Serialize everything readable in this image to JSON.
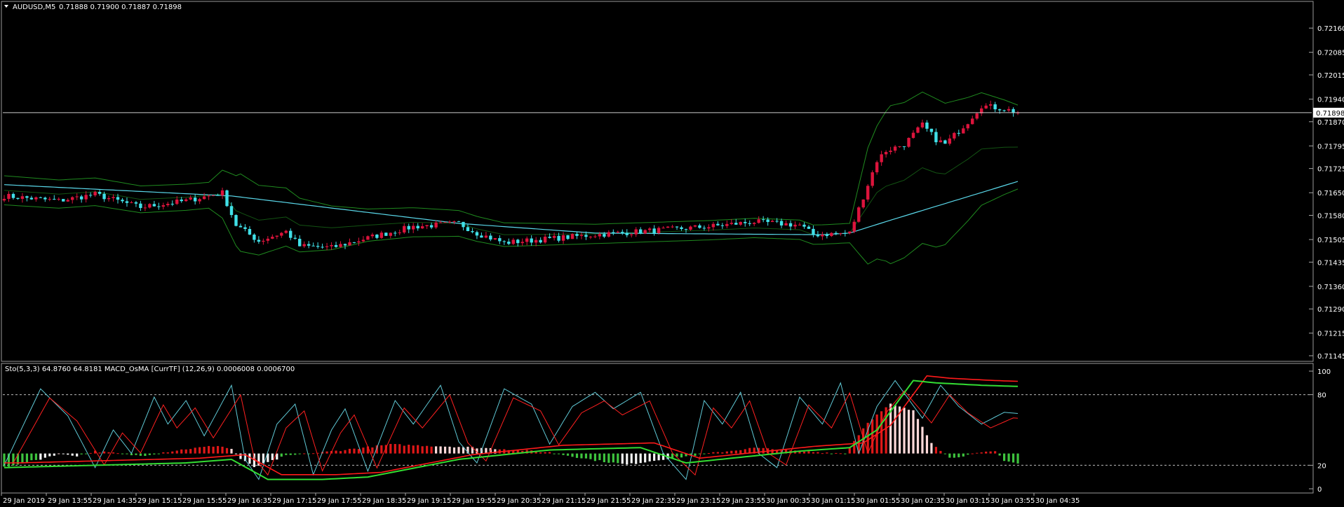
{
  "header": {
    "symbol": "AUDUSD,M5",
    "ohlc": "0.71888 0.71900 0.71887 0.71898"
  },
  "subheader": {
    "indicators": "Sto(5,3,3) 64.8760 64.8181  MACD_OsMA [CurrTF] (12,26,9) 0.0006008 0.0006700"
  },
  "colors": {
    "background": "#000000",
    "bull_candle": "#dc143c",
    "bear_candle": "#40e0e8",
    "bollinger": "#1f8a1f",
    "moving_average": "#5ad8ea",
    "stoch_main": "#5fc9d6",
    "stoch_signal": "#ff2020",
    "osma_signal": "#33dd33",
    "price_line": "#cccccc"
  },
  "chart_data": [
    {
      "type": "candlestick",
      "title": "AUDUSD,M5",
      "current_price": "0.71898",
      "ylim": [
        0.71145,
        0.72195
      ],
      "y_ticks": [
        "0.72160",
        "0.72085",
        "0.72015",
        "0.71940",
        "0.71870",
        "0.71795",
        "0.71725",
        "0.71650",
        "0.71580",
        "0.71505",
        "0.71435",
        "0.71360",
        "0.71290",
        "0.71215",
        "0.71145"
      ],
      "x_ticks": [
        "29 Jan 2019",
        "29 Jan 13:55",
        "29 Jan 14:35",
        "29 Jan 15:15",
        "29 Jan 15:55",
        "29 Jan 16:35",
        "29 Jan 17:15",
        "29 Jan 17:55",
        "29 Jan 18:35",
        "29 Jan 19:15",
        "29 Jan 19:55",
        "29 Jan 20:35",
        "29 Jan 21:15",
        "29 Jan 21:55",
        "29 Jan 22:35",
        "29 Jan 23:15",
        "29 Jan 23:55",
        "30 Jan 00:35",
        "30 Jan 01:15",
        "30 Jan 01:55",
        "30 Jan 02:35",
        "30 Jan 03:15",
        "30 Jan 03:55",
        "30 Jan 04:35"
      ],
      "close_anchors": [
        [
          0,
          0.7164
        ],
        [
          12,
          0.71625
        ],
        [
          20,
          0.71645
        ],
        [
          30,
          0.71605
        ],
        [
          40,
          0.71625
        ],
        [
          48,
          0.7165
        ],
        [
          51,
          0.7155
        ],
        [
          56,
          0.715
        ],
        [
          62,
          0.7153
        ],
        [
          65,
          0.71485
        ],
        [
          72,
          0.7148
        ],
        [
          80,
          0.7151
        ],
        [
          90,
          0.71545
        ],
        [
          100,
          0.71555
        ],
        [
          104,
          0.71525
        ],
        [
          110,
          0.71495
        ],
        [
          118,
          0.71505
        ],
        [
          130,
          0.7152
        ],
        [
          145,
          0.71535
        ],
        [
          155,
          0.71545
        ],
        [
          165,
          0.7156
        ],
        [
          175,
          0.7155
        ],
        [
          178,
          0.7152
        ],
        [
          186,
          0.71525
        ],
        [
          192,
          0.7175
        ],
        [
          194,
          0.7178
        ],
        [
          198,
          0.718
        ],
        [
          202,
          0.7186
        ],
        [
          205,
          0.71815
        ],
        [
          207,
          0.718
        ],
        [
          212,
          0.7187
        ],
        [
          215,
          0.7192
        ],
        [
          220,
          0.7191
        ],
        [
          223,
          0.71898
        ]
      ],
      "ma_anchors": [
        [
          0,
          0.71675
        ],
        [
          50,
          0.7164
        ],
        [
          100,
          0.71555
        ],
        [
          130,
          0.71525
        ],
        [
          180,
          0.7152
        ],
        [
          186,
          0.71525
        ],
        [
          195,
          0.71565
        ],
        [
          223,
          0.71685
        ]
      ],
      "bb_width_anchors": [
        [
          0,
          0.00045
        ],
        [
          45,
          0.0004
        ],
        [
          52,
          0.0012
        ],
        [
          62,
          0.0009
        ],
        [
          80,
          0.0005
        ],
        [
          100,
          0.0004
        ],
        [
          130,
          0.0003
        ],
        [
          186,
          0.0003
        ],
        [
          190,
          0.0018
        ],
        [
          195,
          0.00245
        ],
        [
          205,
          0.0023
        ],
        [
          223,
          0.0013
        ]
      ]
    },
    {
      "type": "oscillator",
      "title": "Sto(5,3,3) / MACD_OsMA",
      "ylim": [
        0,
        100
      ],
      "y_ticks": [
        "100",
        "80",
        "20",
        "0"
      ],
      "levels": [
        80,
        20
      ],
      "stoch_main": 64.876,
      "stoch_signal": 64.8181,
      "osma_value": 0.0006008,
      "signal_value": 0.00067,
      "stoch_anchors": [
        [
          0,
          20
        ],
        [
          8,
          85
        ],
        [
          14,
          62
        ],
        [
          20,
          18
        ],
        [
          24,
          50
        ],
        [
          28,
          30
        ],
        [
          33,
          78
        ],
        [
          36,
          55
        ],
        [
          40,
          75
        ],
        [
          44,
          45
        ],
        [
          50,
          88
        ],
        [
          53,
          25
        ],
        [
          56,
          8
        ],
        [
          60,
          55
        ],
        [
          64,
          72
        ],
        [
          68,
          12
        ],
        [
          72,
          50
        ],
        [
          75,
          68
        ],
        [
          80,
          15
        ],
        [
          86,
          75
        ],
        [
          90,
          55
        ],
        [
          96,
          88
        ],
        [
          100,
          40
        ],
        [
          104,
          22
        ],
        [
          110,
          85
        ],
        [
          116,
          72
        ],
        [
          120,
          38
        ],
        [
          125,
          70
        ],
        [
          130,
          82
        ],
        [
          134,
          68
        ],
        [
          140,
          82
        ],
        [
          145,
          30
        ],
        [
          150,
          8
        ],
        [
          154,
          75
        ],
        [
          158,
          55
        ],
        [
          162,
          82
        ],
        [
          166,
          30
        ],
        [
          170,
          18
        ],
        [
          175,
          78
        ],
        [
          180,
          55
        ],
        [
          184,
          90
        ],
        [
          188,
          30
        ],
        [
          192,
          70
        ],
        [
          196,
          92
        ],
        [
          202,
          60
        ],
        [
          206,
          88
        ],
        [
          210,
          70
        ],
        [
          215,
          55
        ],
        [
          220,
          65
        ],
        [
          223,
          64
        ]
      ],
      "signal_anchors": [
        [
          0,
          18
        ],
        [
          20,
          20
        ],
        [
          40,
          22
        ],
        [
          50,
          25
        ],
        [
          58,
          8
        ],
        [
          70,
          8
        ],
        [
          80,
          10
        ],
        [
          100,
          25
        ],
        [
          120,
          33
        ],
        [
          140,
          35
        ],
        [
          150,
          22
        ],
        [
          175,
          32
        ],
        [
          186,
          35
        ],
        [
          192,
          50
        ],
        [
          200,
          92
        ],
        [
          205,
          90
        ],
        [
          215,
          88
        ],
        [
          223,
          87
        ]
      ],
      "osma_anchors": [
        [
          0,
          -12
        ],
        [
          8,
          -5
        ],
        [
          12,
          0
        ],
        [
          16,
          -2
        ],
        [
          20,
          2
        ],
        [
          30,
          -2
        ],
        [
          40,
          4
        ],
        [
          47,
          7
        ],
        [
          50,
          4
        ],
        [
          52,
          -5
        ],
        [
          55,
          -12
        ],
        [
          58,
          -8
        ],
        [
          62,
          -2
        ],
        [
          70,
          1
        ],
        [
          85,
          8
        ],
        [
          100,
          6
        ],
        [
          110,
          4
        ],
        [
          120,
          1
        ],
        [
          130,
          -6
        ],
        [
          137,
          -10
        ],
        [
          145,
          -5
        ],
        [
          155,
          0
        ],
        [
          165,
          5
        ],
        [
          175,
          2
        ],
        [
          185,
          0
        ],
        [
          190,
          28
        ],
        [
          195,
          44
        ],
        [
          200,
          38
        ],
        [
          204,
          10
        ],
        [
          208,
          -4
        ],
        [
          214,
          0
        ],
        [
          218,
          2
        ],
        [
          220,
          -6
        ],
        [
          223,
          -9
        ]
      ],
      "osma_white_ranges": [
        [
          8,
          16
        ],
        [
          50,
          60
        ],
        [
          95,
          108
        ],
        [
          136,
          146
        ],
        [
          195,
          204
        ]
      ]
    }
  ]
}
